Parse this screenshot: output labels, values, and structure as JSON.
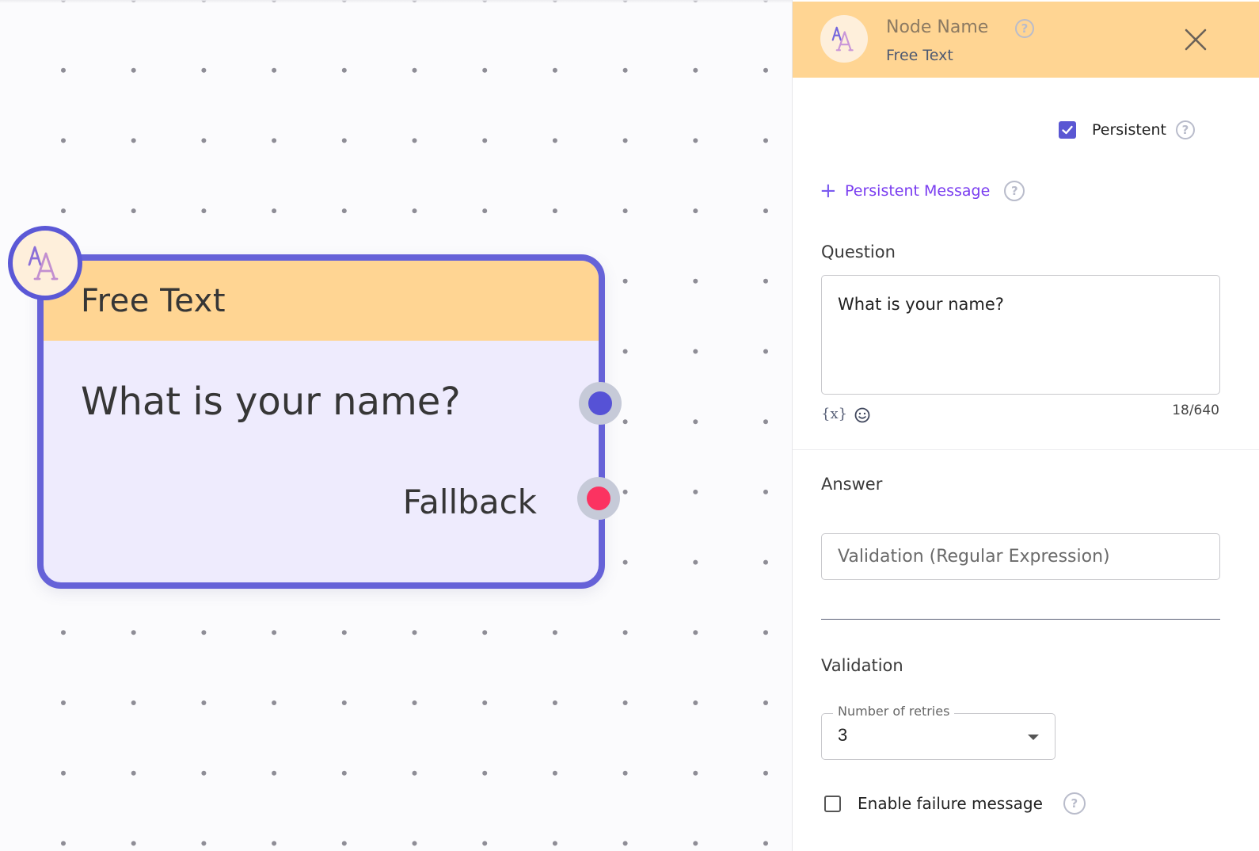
{
  "canvas": {
    "node": {
      "title": "Free Text",
      "question": "What is your name?",
      "fallback_label": "Fallback",
      "icon": "text-font-icon",
      "colors": {
        "border": "#6662d8",
        "header": "#ffd593",
        "body": "#eeebfd",
        "output_port": "#5652d6",
        "fallback_port": "#fb3361"
      }
    }
  },
  "panel": {
    "header": {
      "node_name_label": "Node Name",
      "node_type": "Free Text",
      "help_icon": "?",
      "close_icon": "close-icon"
    },
    "persistent": {
      "label": "Persistent",
      "checked": true,
      "help_icon": "?"
    },
    "persistent_message": {
      "plus": "+",
      "label": "Persistent Message",
      "help_icon": "?"
    },
    "question": {
      "title": "Question",
      "value": "What is your name?",
      "variable_icon": "{x}",
      "char_count": "18/640"
    },
    "answer": {
      "title": "Answer",
      "regex_placeholder": "Validation (Regular Expression)"
    },
    "validation": {
      "title": "Validation",
      "retries_label": "Number of retries",
      "retries_value": "3",
      "failure_message_label": "Enable failure message",
      "failure_message_checked": false,
      "help_icon": "?"
    },
    "colors": {
      "accent": "#5a57d3",
      "link": "#7a3df0"
    }
  }
}
